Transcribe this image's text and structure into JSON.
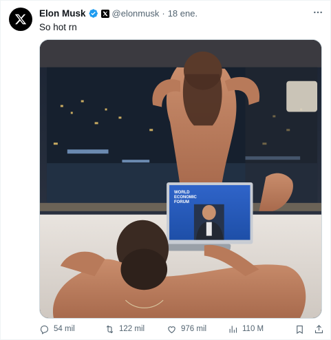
{
  "author": {
    "name": "Elon Musk",
    "handle": "@elonmusk",
    "separator": "·",
    "date": "18 ene."
  },
  "tweet": {
    "text": "So hot rn"
  },
  "media": {
    "laptop_screen_logo_lines": [
      "WORLD",
      "ECONOMIC",
      "FORUM"
    ]
  },
  "actions": {
    "replies": "54 mil",
    "reposts": "122 mil",
    "likes": "976 mil",
    "views": "110 M"
  },
  "icons": {
    "avatar": "x-logo-icon",
    "verified": "verified-badge-icon",
    "affiliation": "x-affiliation-icon",
    "more": "more-icon",
    "reply": "reply-icon",
    "repost": "repost-icon",
    "like": "heart-icon",
    "views": "views-icon",
    "bookmark": "bookmark-icon",
    "share": "share-icon"
  },
  "colors": {
    "text_primary": "#0f1419",
    "text_secondary": "#536471",
    "verified_blue": "#1d9bf0",
    "border": "#cfd9de"
  }
}
